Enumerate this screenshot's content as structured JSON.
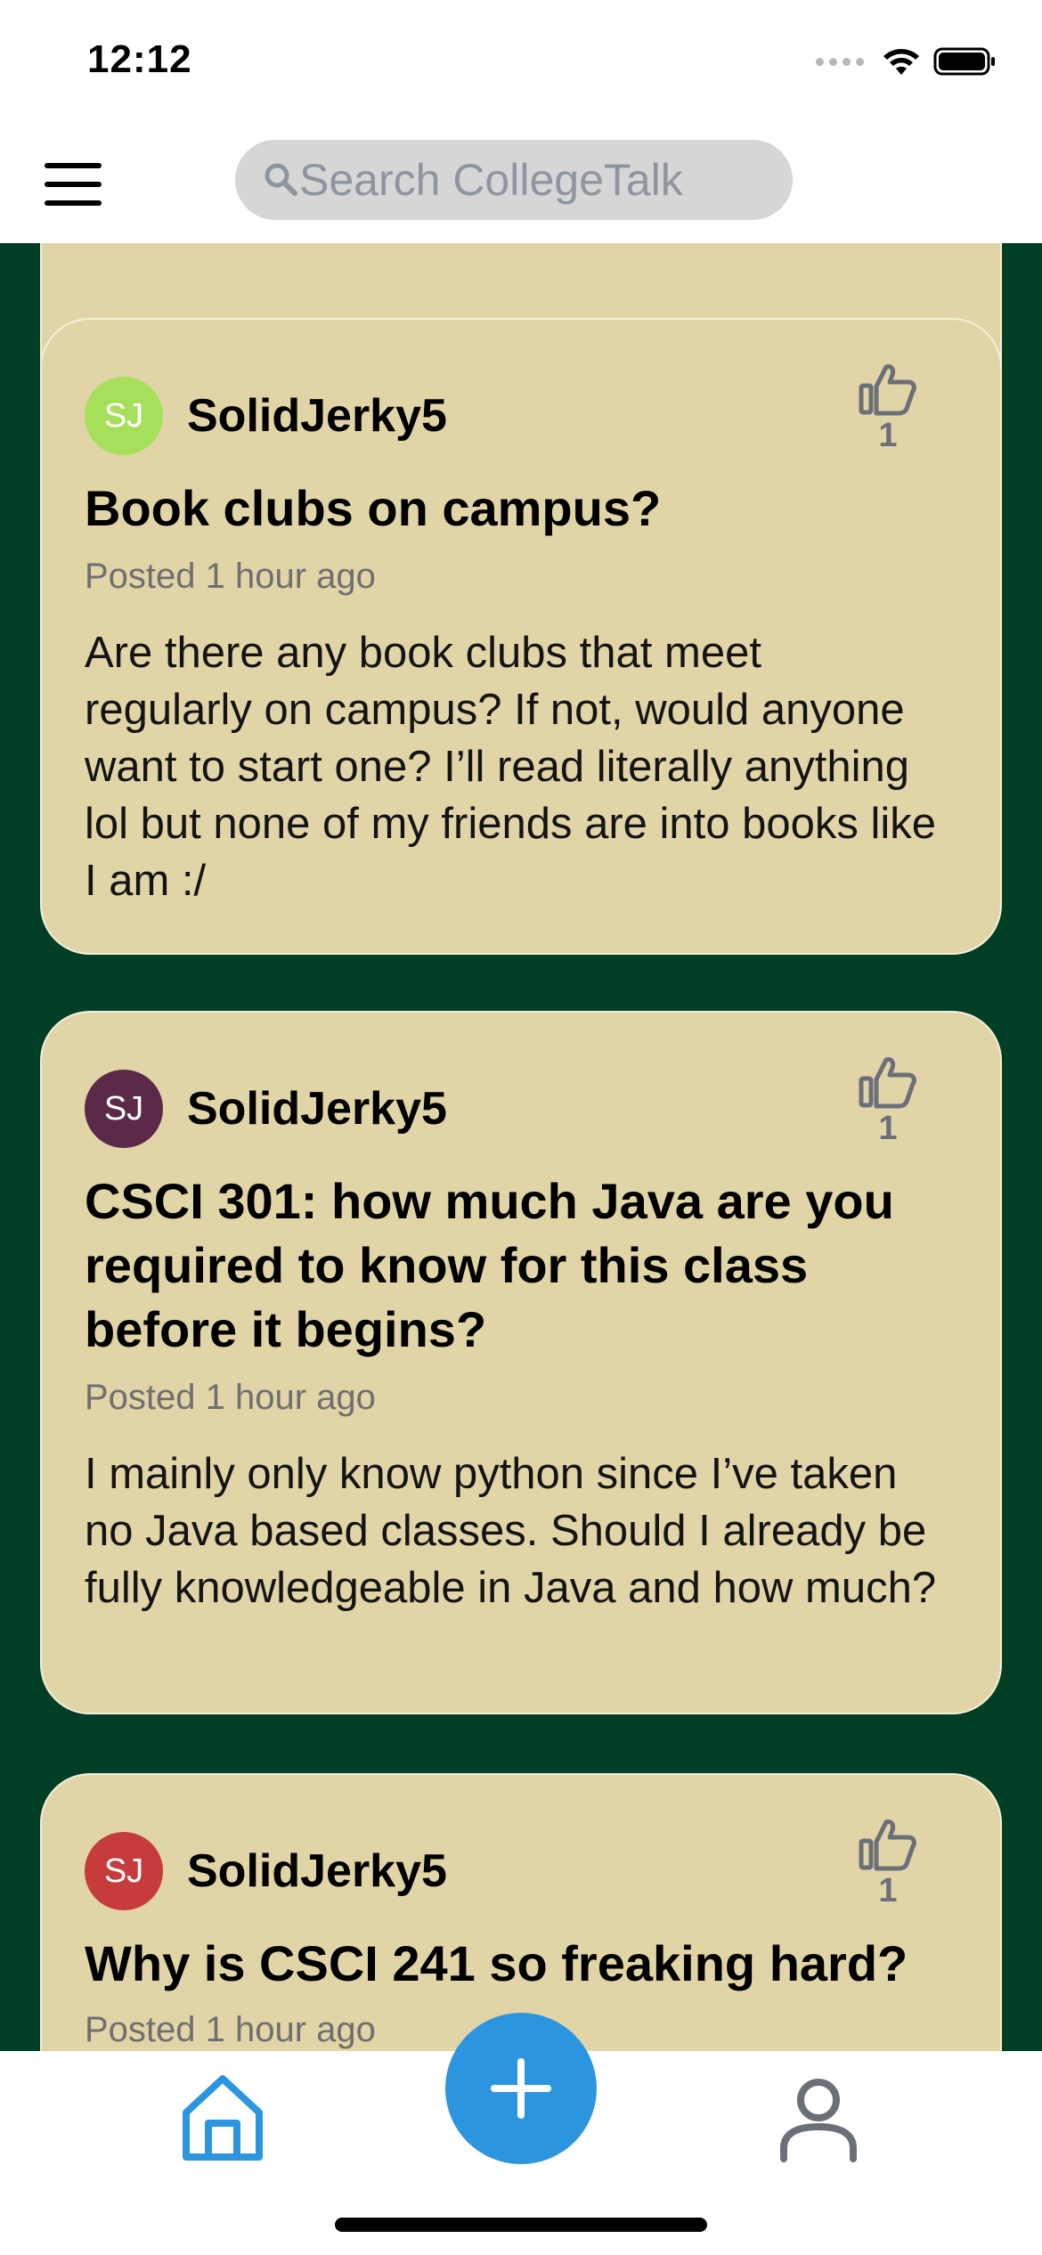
{
  "status_bar": {
    "time": "12:12"
  },
  "header": {
    "search_placeholder": "Search CollegeTalk"
  },
  "posts": [
    {
      "avatar_initials": "SJ",
      "avatar_color": "#a6e05a",
      "username": "SolidJerky5",
      "likes": "1",
      "title": "Book clubs on campus?",
      "posted": "Posted 1 hour ago",
      "body": "Are there any book clubs that meet regularly on campus? If not, would anyone want to start one? I’ll read literally anything lol but none of my friends are into books like I am :/"
    },
    {
      "avatar_initials": "SJ",
      "avatar_color": "#5a2a48",
      "username": "SolidJerky5",
      "likes": "1",
      "title": "CSCI 301: how much Java are you required to know for this class before it begins?",
      "posted": "Posted 1 hour ago",
      "body": "I mainly only know python since I’ve taken no Java based classes. Should I already be fully knowledgeable in Java and how much?"
    },
    {
      "avatar_initials": "SJ",
      "avatar_color": "#c63c3c",
      "username": "SolidJerky5",
      "likes": "1",
      "title": "Why is CSCI 241 so freaking hard?",
      "posted": "Posted 1 hour ago",
      "body": ""
    }
  ],
  "nav": {
    "home_icon": "home-icon",
    "add_icon": "plus-icon",
    "profile_icon": "person-icon",
    "accent_color": "#2c95df"
  }
}
